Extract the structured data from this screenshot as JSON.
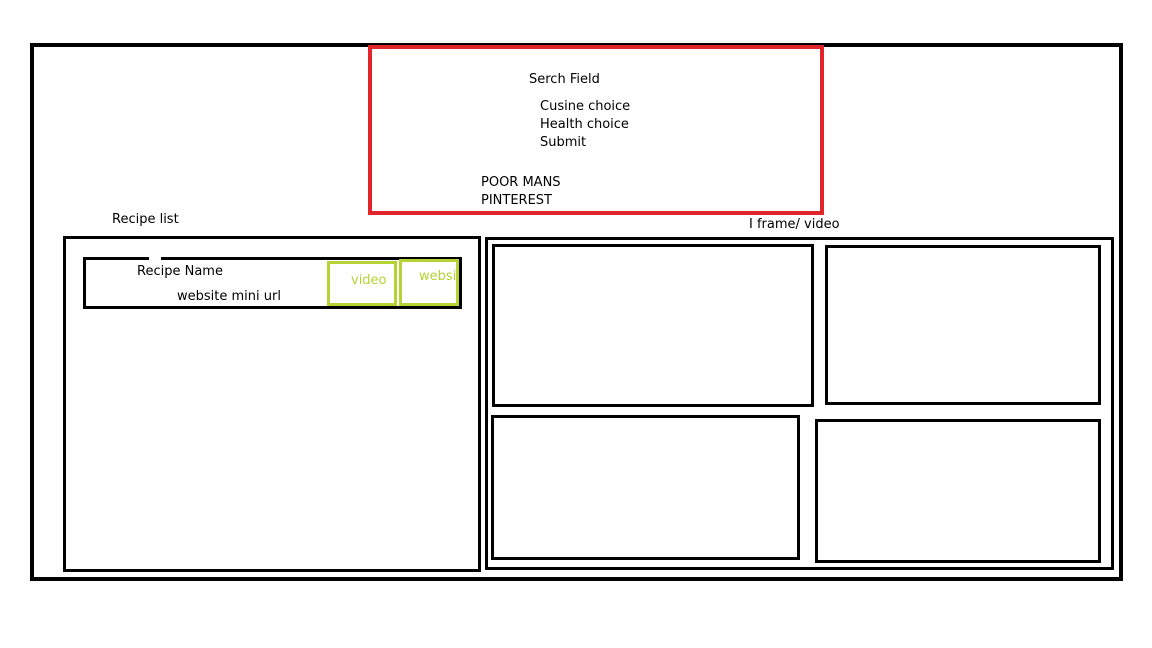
{
  "header": {
    "search_label": "Serch Field",
    "cuisine_label": "Cusine choice",
    "health_label": "Health choice",
    "submit_label": "Submit",
    "brand_line1": "POOR MANS",
    "brand_line2": "PINTEREST"
  },
  "recipe_list": {
    "title": "Recipe list",
    "items": [
      {
        "name": "Recipe Name",
        "url_label": "website mini url",
        "video_button": "video",
        "website_button": "website"
      }
    ]
  },
  "frames": {
    "title": "I frame/ video"
  },
  "colors": {
    "search_border": "#e0252b",
    "button_green": "#b5d335",
    "outline": "#000000"
  }
}
